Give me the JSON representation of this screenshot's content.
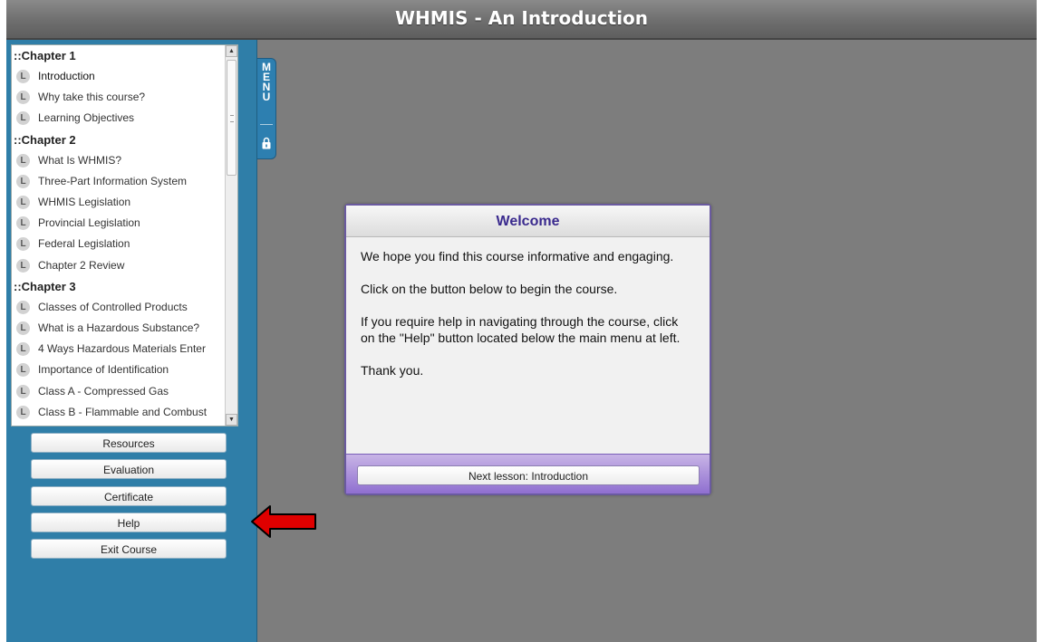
{
  "window": {
    "title": "WHMIS - An Introduction"
  },
  "menu": {
    "tab_letters": [
      "M",
      "E",
      "N",
      "U"
    ],
    "chapters": [
      {
        "title": "::Chapter 1",
        "lessons": [
          {
            "label": "Introduction",
            "icon": "L"
          },
          {
            "label": "Why take this course?",
            "icon": "L"
          },
          {
            "label": "Learning Objectives",
            "icon": "L"
          }
        ]
      },
      {
        "title": "::Chapter 2",
        "lessons": [
          {
            "label": "What Is WHMIS?",
            "icon": "L"
          },
          {
            "label": "Three-Part Information System",
            "icon": "L"
          },
          {
            "label": "WHMIS Legislation",
            "icon": "L"
          },
          {
            "label": "Provincial Legislation",
            "icon": "L"
          },
          {
            "label": "Federal Legislation",
            "icon": "L"
          },
          {
            "label": "Chapter 2 Review",
            "icon": "L"
          }
        ]
      },
      {
        "title": "::Chapter 3",
        "lessons": [
          {
            "label": "Classes of Controlled Products",
            "icon": "L"
          },
          {
            "label": "What is a Hazardous Substance?",
            "icon": "L"
          },
          {
            "label": "4 Ways Hazardous Materials Enter",
            "icon": "L"
          },
          {
            "label": "Importance of Identification",
            "icon": "L"
          },
          {
            "label": "Class A - Compressed Gas",
            "icon": "L"
          },
          {
            "label": "Class B - Flammable and Combust",
            "icon": "L"
          }
        ]
      }
    ]
  },
  "sidebar_buttons": {
    "resources": "Resources",
    "evaluation": "Evaluation",
    "certificate": "Certificate",
    "help": "Help",
    "exit": "Exit Course"
  },
  "dialog": {
    "title": "Welcome",
    "paragraphs": [
      "We hope you find this course informative and engaging.",
      "Click on the button below to begin the course.",
      "If you require help in navigating through the course, click on the \"Help\" button located below the main menu at left.",
      "Thank you."
    ],
    "next_button": "Next lesson: Introduction"
  },
  "colors": {
    "sidebar": "#2f7ea8",
    "content_bg": "#7d7d7d",
    "dialog_accent": "#8f6fd0",
    "dialog_title": "#3a2a8e",
    "arrow": "#e00000"
  }
}
